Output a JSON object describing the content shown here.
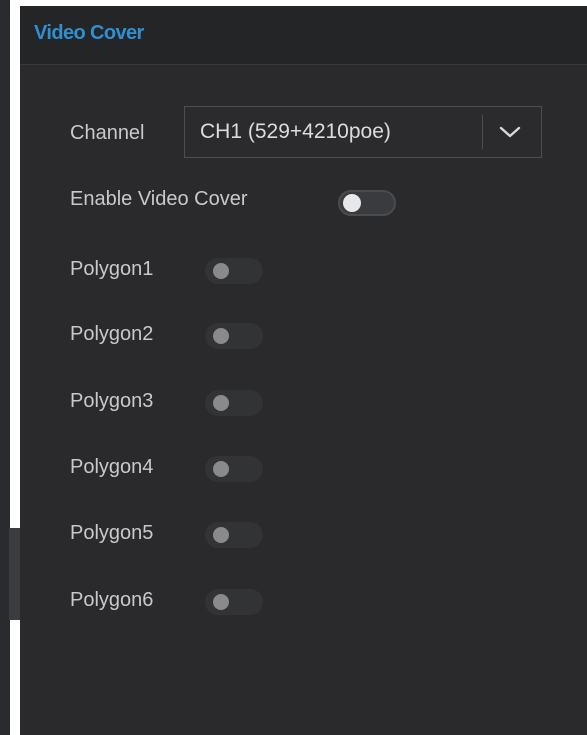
{
  "panel": {
    "title": "Video Cover"
  },
  "channel": {
    "label": "Channel",
    "selected": "CH1 (529+4210poe)"
  },
  "enable_video_cover": {
    "label": "Enable Video Cover",
    "enabled": false
  },
  "polygons": [
    {
      "label": "Polygon1",
      "enabled": false
    },
    {
      "label": "Polygon2",
      "enabled": false
    },
    {
      "label": "Polygon3",
      "enabled": false
    },
    {
      "label": "Polygon4",
      "enabled": false
    },
    {
      "label": "Polygon5",
      "enabled": false
    },
    {
      "label": "Polygon6",
      "enabled": false
    }
  ],
  "colors": {
    "title_accent": "#2f8fd1",
    "panel_background": "#2a2a2c",
    "label_text": "#c9c9cb"
  }
}
